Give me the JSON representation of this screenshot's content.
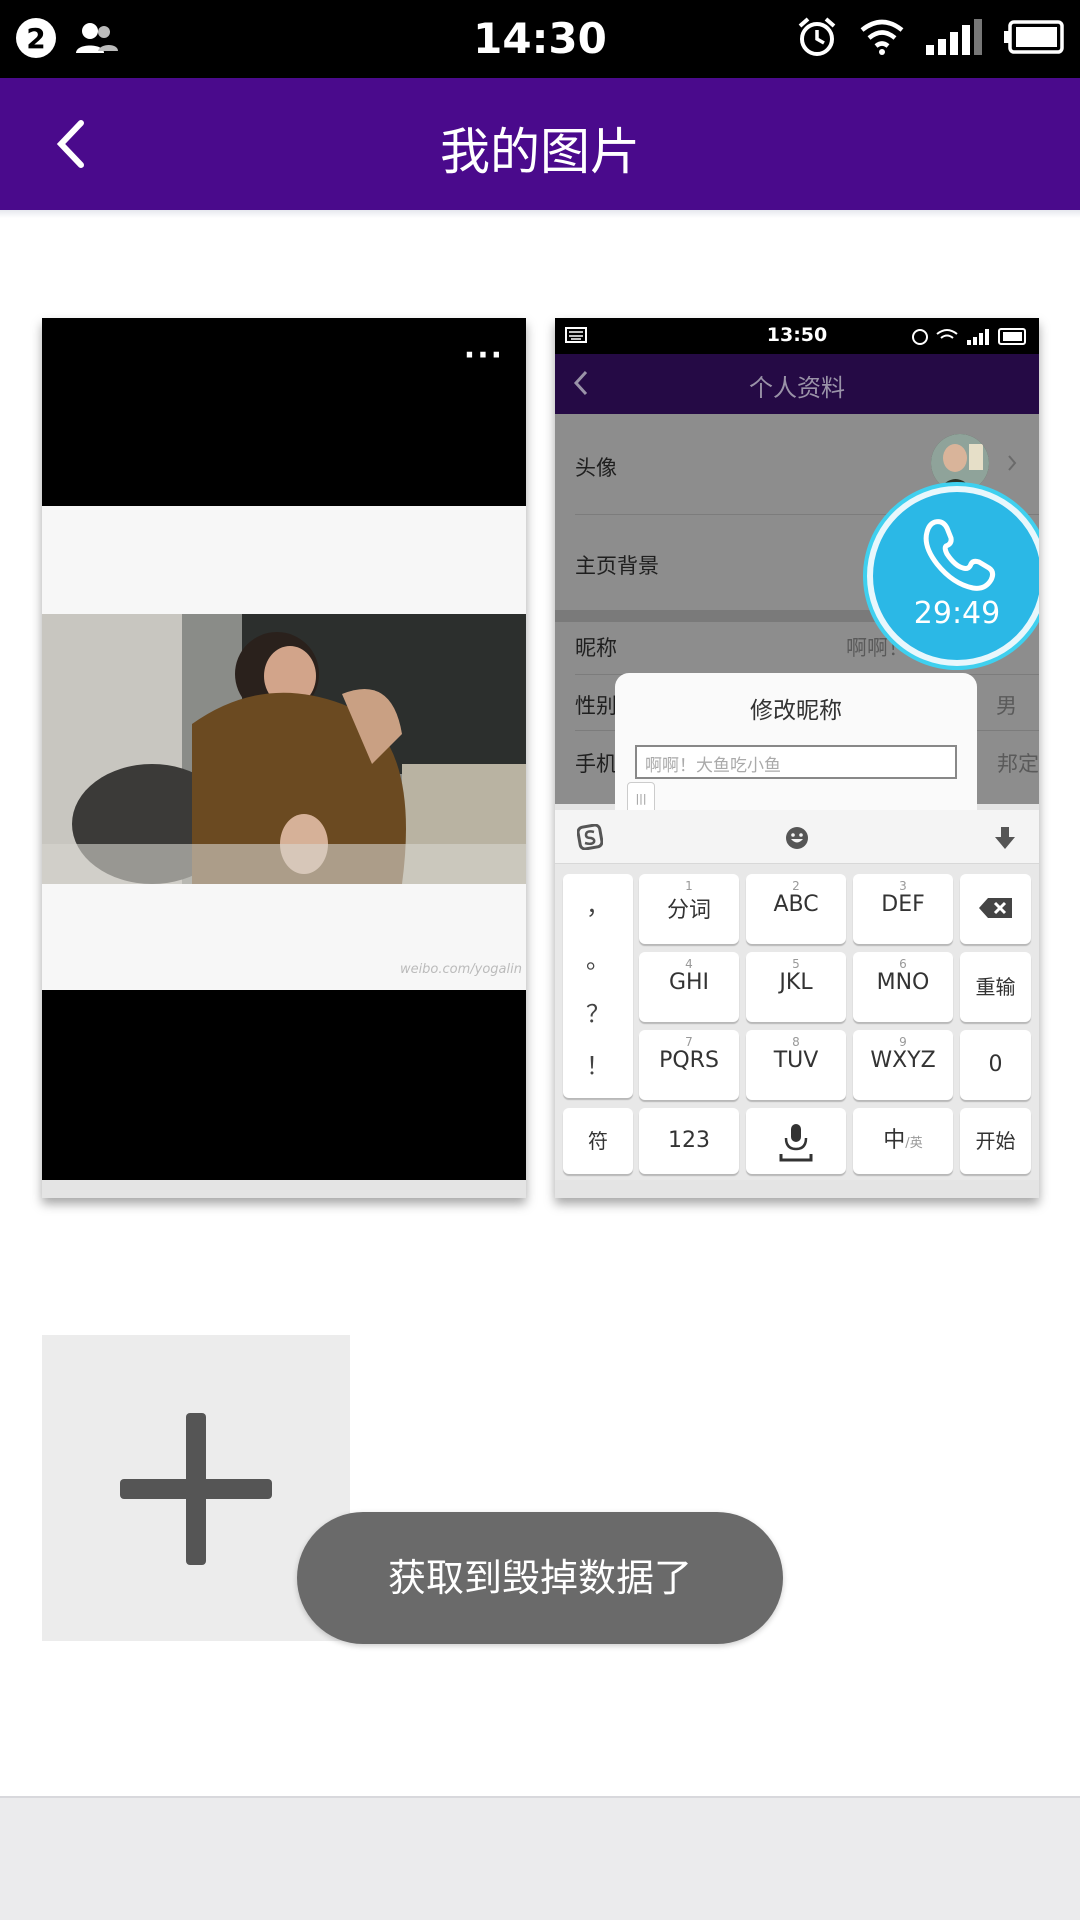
{
  "status_bar": {
    "notification_count": "2",
    "time": "14:30",
    "icons": [
      "user-group-icon",
      "alarm-icon",
      "wifi-icon",
      "signal-icon",
      "battery-icon"
    ]
  },
  "header": {
    "title": "我的图片",
    "back_icon": "chevron-left-icon",
    "background": "#4a0a8c"
  },
  "photos": [
    {
      "kind": "image",
      "menu_label": "···",
      "watermark": "weibo.com/yogalin"
    },
    {
      "kind": "screenshot",
      "status_time": "13:50",
      "screen_title": "个人资料",
      "rows": [
        {
          "label": "头像",
          "value": ""
        },
        {
          "label": "主页背景",
          "value": ""
        },
        {
          "label": "昵称",
          "value": "啊啊！"
        },
        {
          "label": "性别",
          "value": "男"
        },
        {
          "label": "手机",
          "value": "邦定"
        }
      ],
      "dialog": {
        "title": "修改昵称",
        "input_value": "啊啊！大鱼吃小鱼"
      },
      "call_timer": "29:49",
      "keyboard": {
        "side_keys": [
          "，",
          "。",
          "？",
          "！"
        ],
        "rows": [
          [
            {
              "num": "1",
              "label": "分词"
            },
            {
              "num": "2",
              "label": "ABC"
            },
            {
              "num": "3",
              "label": "DEF"
            }
          ],
          [
            {
              "num": "4",
              "label": "GHI"
            },
            {
              "num": "5",
              "label": "JKL"
            },
            {
              "num": "6",
              "label": "MNO"
            }
          ],
          [
            {
              "num": "7",
              "label": "PQRS"
            },
            {
              "num": "8",
              "label": "TUV"
            },
            {
              "num": "9",
              "label": "WXYZ"
            }
          ]
        ],
        "right_keys": [
          "重输",
          "0"
        ],
        "bottom_keys": [
          "符",
          "123",
          "中",
          "英",
          "开始"
        ]
      }
    }
  ],
  "add_button_icon": "plus-icon",
  "toast": "获取到毁掉数据了"
}
